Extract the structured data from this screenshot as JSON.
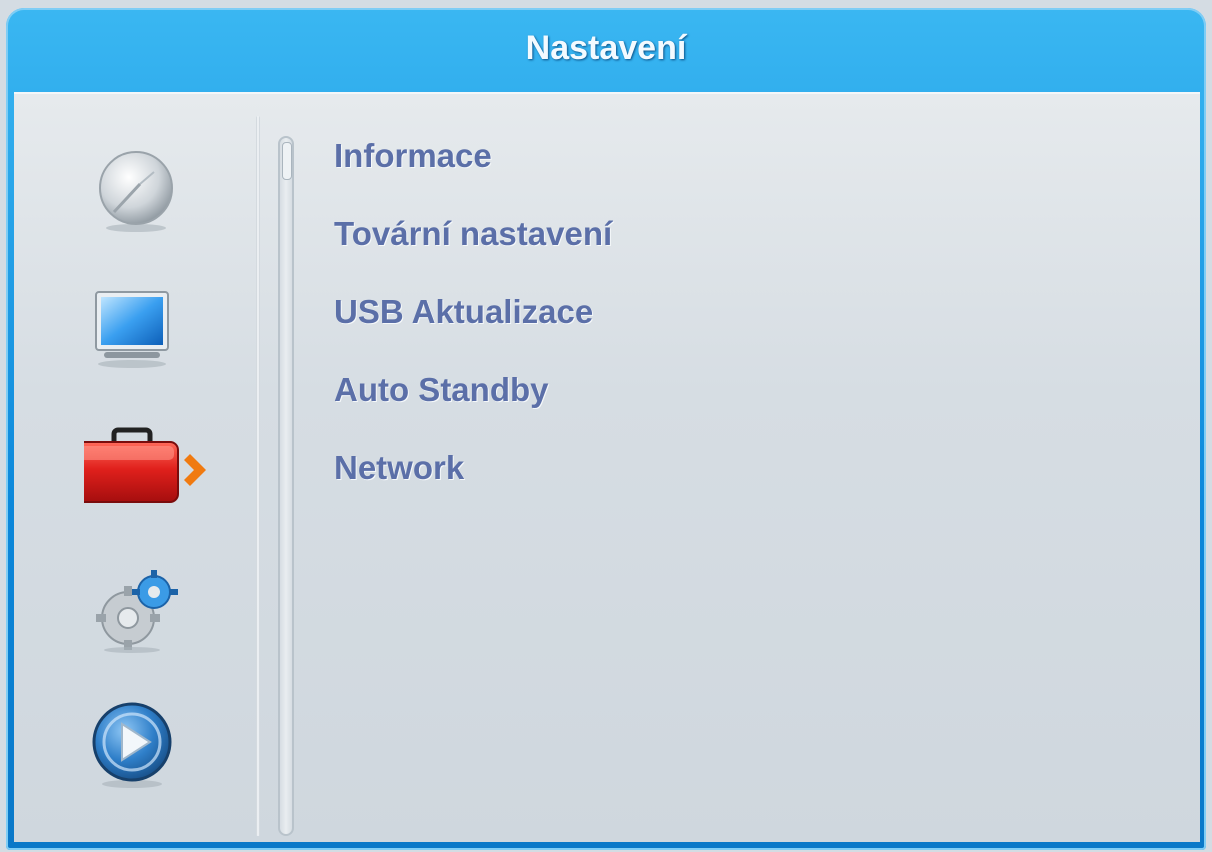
{
  "window": {
    "title": "Nastavení"
  },
  "sidebar": {
    "items": [
      {
        "icon": "satellite-dish-icon",
        "active": false
      },
      {
        "icon": "tv-monitor-icon",
        "active": false
      },
      {
        "icon": "toolbox-icon",
        "active": true
      },
      {
        "icon": "settings-gears-icon",
        "active": false
      },
      {
        "icon": "media-play-icon",
        "active": false
      }
    ]
  },
  "menu": {
    "items": [
      {
        "label": "Informace"
      },
      {
        "label": "Tovární nastavení"
      },
      {
        "label": "USB Aktualizace"
      },
      {
        "label": "Auto Standby"
      },
      {
        "label": "Network"
      }
    ]
  },
  "colors": {
    "title_bar": "#0b87da",
    "menu_text": "#5b6fa8",
    "active_toolbox": "#e02020",
    "selection_arrow": "#f07a10"
  }
}
